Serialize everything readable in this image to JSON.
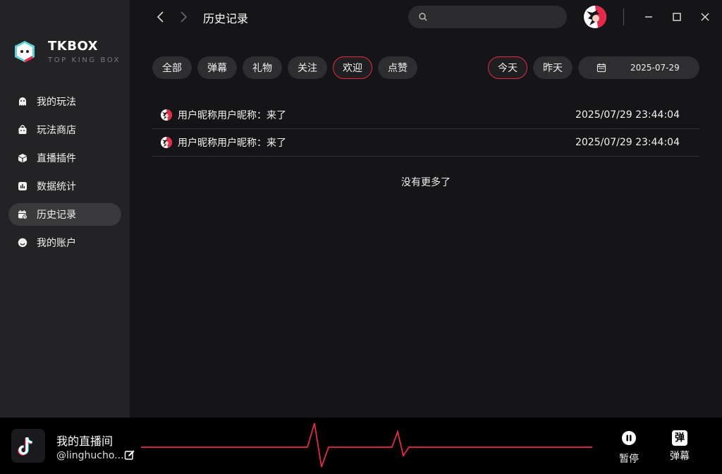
{
  "app": {
    "name": "TKBOX",
    "tagline": "TOP KING BOX"
  },
  "sidebar": {
    "items": [
      {
        "label": "我的玩法",
        "icon": "ghost-icon"
      },
      {
        "label": "玩法商店",
        "icon": "shopping-bag-icon"
      },
      {
        "label": "直播插件",
        "icon": "cube-icon"
      },
      {
        "label": "数据统计",
        "icon": "bar-chart-icon"
      },
      {
        "label": "历史记录",
        "icon": "calendar-history-icon",
        "active": true
      },
      {
        "label": "我的账户",
        "icon": "smiley-icon"
      }
    ]
  },
  "header": {
    "title": "历史记录",
    "search": {
      "value": "",
      "placeholder": ""
    }
  },
  "filters": {
    "types": [
      {
        "label": "全部",
        "active": false
      },
      {
        "label": "弹幕",
        "active": false
      },
      {
        "label": "礼物",
        "active": false
      },
      {
        "label": "关注",
        "active": false
      },
      {
        "label": "欢迎",
        "active": true
      },
      {
        "label": "点赞",
        "active": false
      }
    ],
    "days": [
      {
        "label": "今天",
        "active": true
      },
      {
        "label": "昨天",
        "active": false
      }
    ],
    "date": "2025-07-29"
  },
  "records": [
    {
      "text": "用户昵称用户昵称：来了",
      "time": "2025/07/29 23:44:04"
    },
    {
      "text": "用户昵称用户昵称：来了",
      "time": "2025/07/29 23:44:04"
    }
  ],
  "no_more": "没有更多了",
  "bottom": {
    "room_name": "我的直播间",
    "handle": "@linghucho...",
    "pause_label": "暂停",
    "danmaku_label": "弹幕",
    "danmaku_icon_char": "弹"
  },
  "colors": {
    "accent": "#e8284a",
    "sidebar_bg": "#232325",
    "main_bg": "#151517",
    "chip_bg": "#2e2e30"
  }
}
